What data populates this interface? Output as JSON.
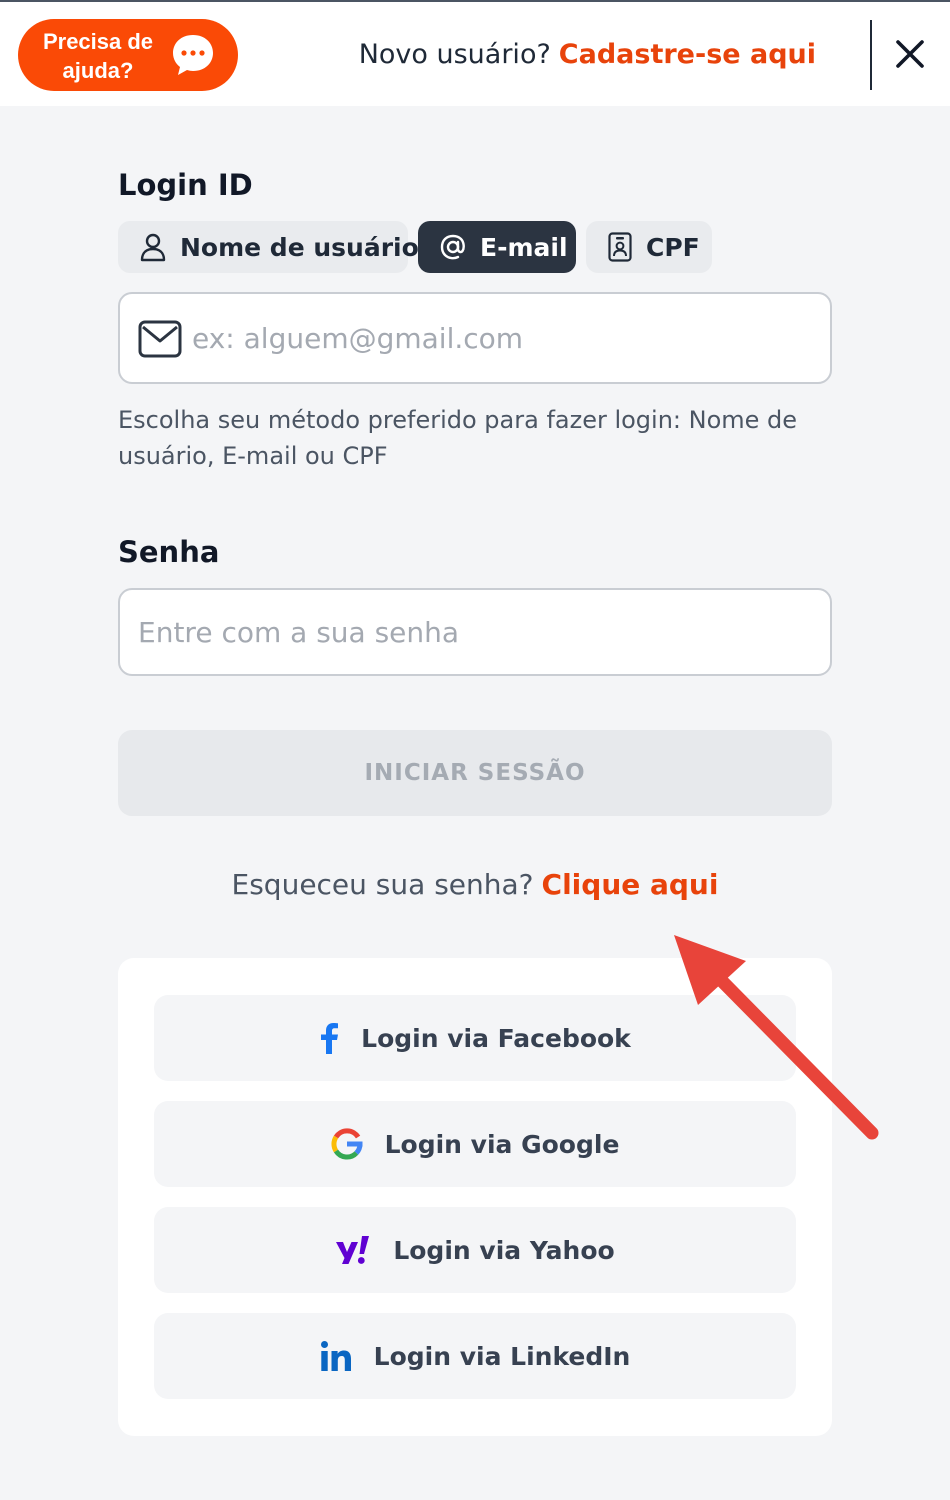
{
  "header": {
    "help_label": "Precisa de\najuda?",
    "new_user_text": "Novo usuário?",
    "signup_link": "Cadastre-se aqui"
  },
  "login_id": {
    "label": "Login ID",
    "tabs": [
      {
        "label": "Nome de usuário",
        "icon": "user-icon",
        "active": false
      },
      {
        "label": "E-mail",
        "icon": "at-sign-icon",
        "active": true
      },
      {
        "label": "CPF",
        "icon": "id-card-icon",
        "active": false
      }
    ],
    "email_placeholder": "ex: alguem@gmail.com",
    "hint": "Escolha seu método preferido para fazer login: Nome de usuário, E-mail ou CPF"
  },
  "password": {
    "label": "Senha",
    "placeholder": "Entre com a sua senha"
  },
  "submit_label": "INICIAR SESSÃO",
  "forgot": {
    "text": "Esqueceu sua senha?",
    "link": "Clique aqui"
  },
  "social": [
    {
      "label": "Login via Facebook",
      "icon": "facebook-icon"
    },
    {
      "label": "Login via Google",
      "icon": "google-icon"
    },
    {
      "label": "Login via Yahoo",
      "icon": "yahoo-icon"
    },
    {
      "label": "Login via LinkedIn",
      "icon": "linkedin-icon"
    }
  ],
  "colors": {
    "brand_orange": "#fa4a06",
    "link_orange": "#e8430b",
    "active_tab": "#2b3441",
    "annotation_arrow": "#e8443a"
  }
}
